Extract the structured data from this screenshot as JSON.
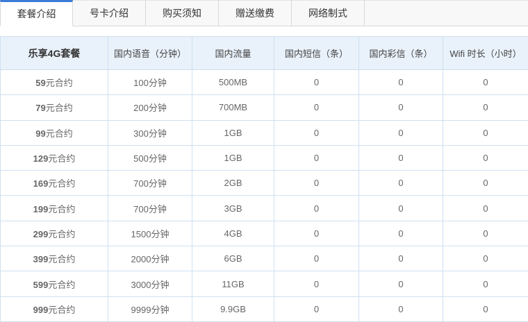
{
  "tabs": {
    "items": [
      {
        "label": "套餐介绍",
        "active": true
      },
      {
        "label": "号卡介绍",
        "active": false
      },
      {
        "label": "购买须知",
        "active": false
      },
      {
        "label": "赠送缴费",
        "active": false
      },
      {
        "label": "网络制式",
        "active": false
      }
    ]
  },
  "colors": {
    "accent_blue": "#3a7ad9",
    "tab_border": "#d8d8d8",
    "tab_inactive_bg": "#f8f8f8",
    "table_border": "#cfe0f2",
    "table_header_bg": "#e9f1fa"
  },
  "table": {
    "headers": [
      "乐享4G套餐",
      "国内语音（分钟）",
      "国内流量",
      "国内短信（条）",
      "国内彩信（条）",
      "Wifi 时长（小时）"
    ],
    "rows": [
      {
        "plan_num": "59",
        "plan_unit": "元合约",
        "voice": "100分钟",
        "data": "500MB",
        "sms": "0",
        "mms": "0",
        "wifi": "0"
      },
      {
        "plan_num": "79",
        "plan_unit": "元合约",
        "voice": "200分钟",
        "data": "700MB",
        "sms": "0",
        "mms": "0",
        "wifi": "0"
      },
      {
        "plan_num": "99",
        "plan_unit": "元合约",
        "voice": "300分钟",
        "data": "1GB",
        "sms": "0",
        "mms": "0",
        "wifi": "0"
      },
      {
        "plan_num": "129",
        "plan_unit": "元合约",
        "voice": "500分钟",
        "data": "1GB",
        "sms": "0",
        "mms": "0",
        "wifi": "0"
      },
      {
        "plan_num": "169",
        "plan_unit": "元合约",
        "voice": "700分钟",
        "data": "2GB",
        "sms": "0",
        "mms": "0",
        "wifi": "0"
      },
      {
        "plan_num": "199",
        "plan_unit": "元合约",
        "voice": "700分钟",
        "data": "3GB",
        "sms": "0",
        "mms": "0",
        "wifi": "0"
      },
      {
        "plan_num": "299",
        "plan_unit": "元合约",
        "voice": "1500分钟",
        "data": "4GB",
        "sms": "0",
        "mms": "0",
        "wifi": "0"
      },
      {
        "plan_num": "399",
        "plan_unit": "元合约",
        "voice": "2000分钟",
        "data": "6GB",
        "sms": "0",
        "mms": "0",
        "wifi": "0"
      },
      {
        "plan_num": "599",
        "plan_unit": "元合约",
        "voice": "3000分钟",
        "data": "11GB",
        "sms": "0",
        "mms": "0",
        "wifi": "0"
      },
      {
        "plan_num": "999",
        "plan_unit": "元合约",
        "voice": "9999分钟",
        "data": "9.9GB",
        "sms": "0",
        "mms": "0",
        "wifi": "0"
      }
    ]
  }
}
